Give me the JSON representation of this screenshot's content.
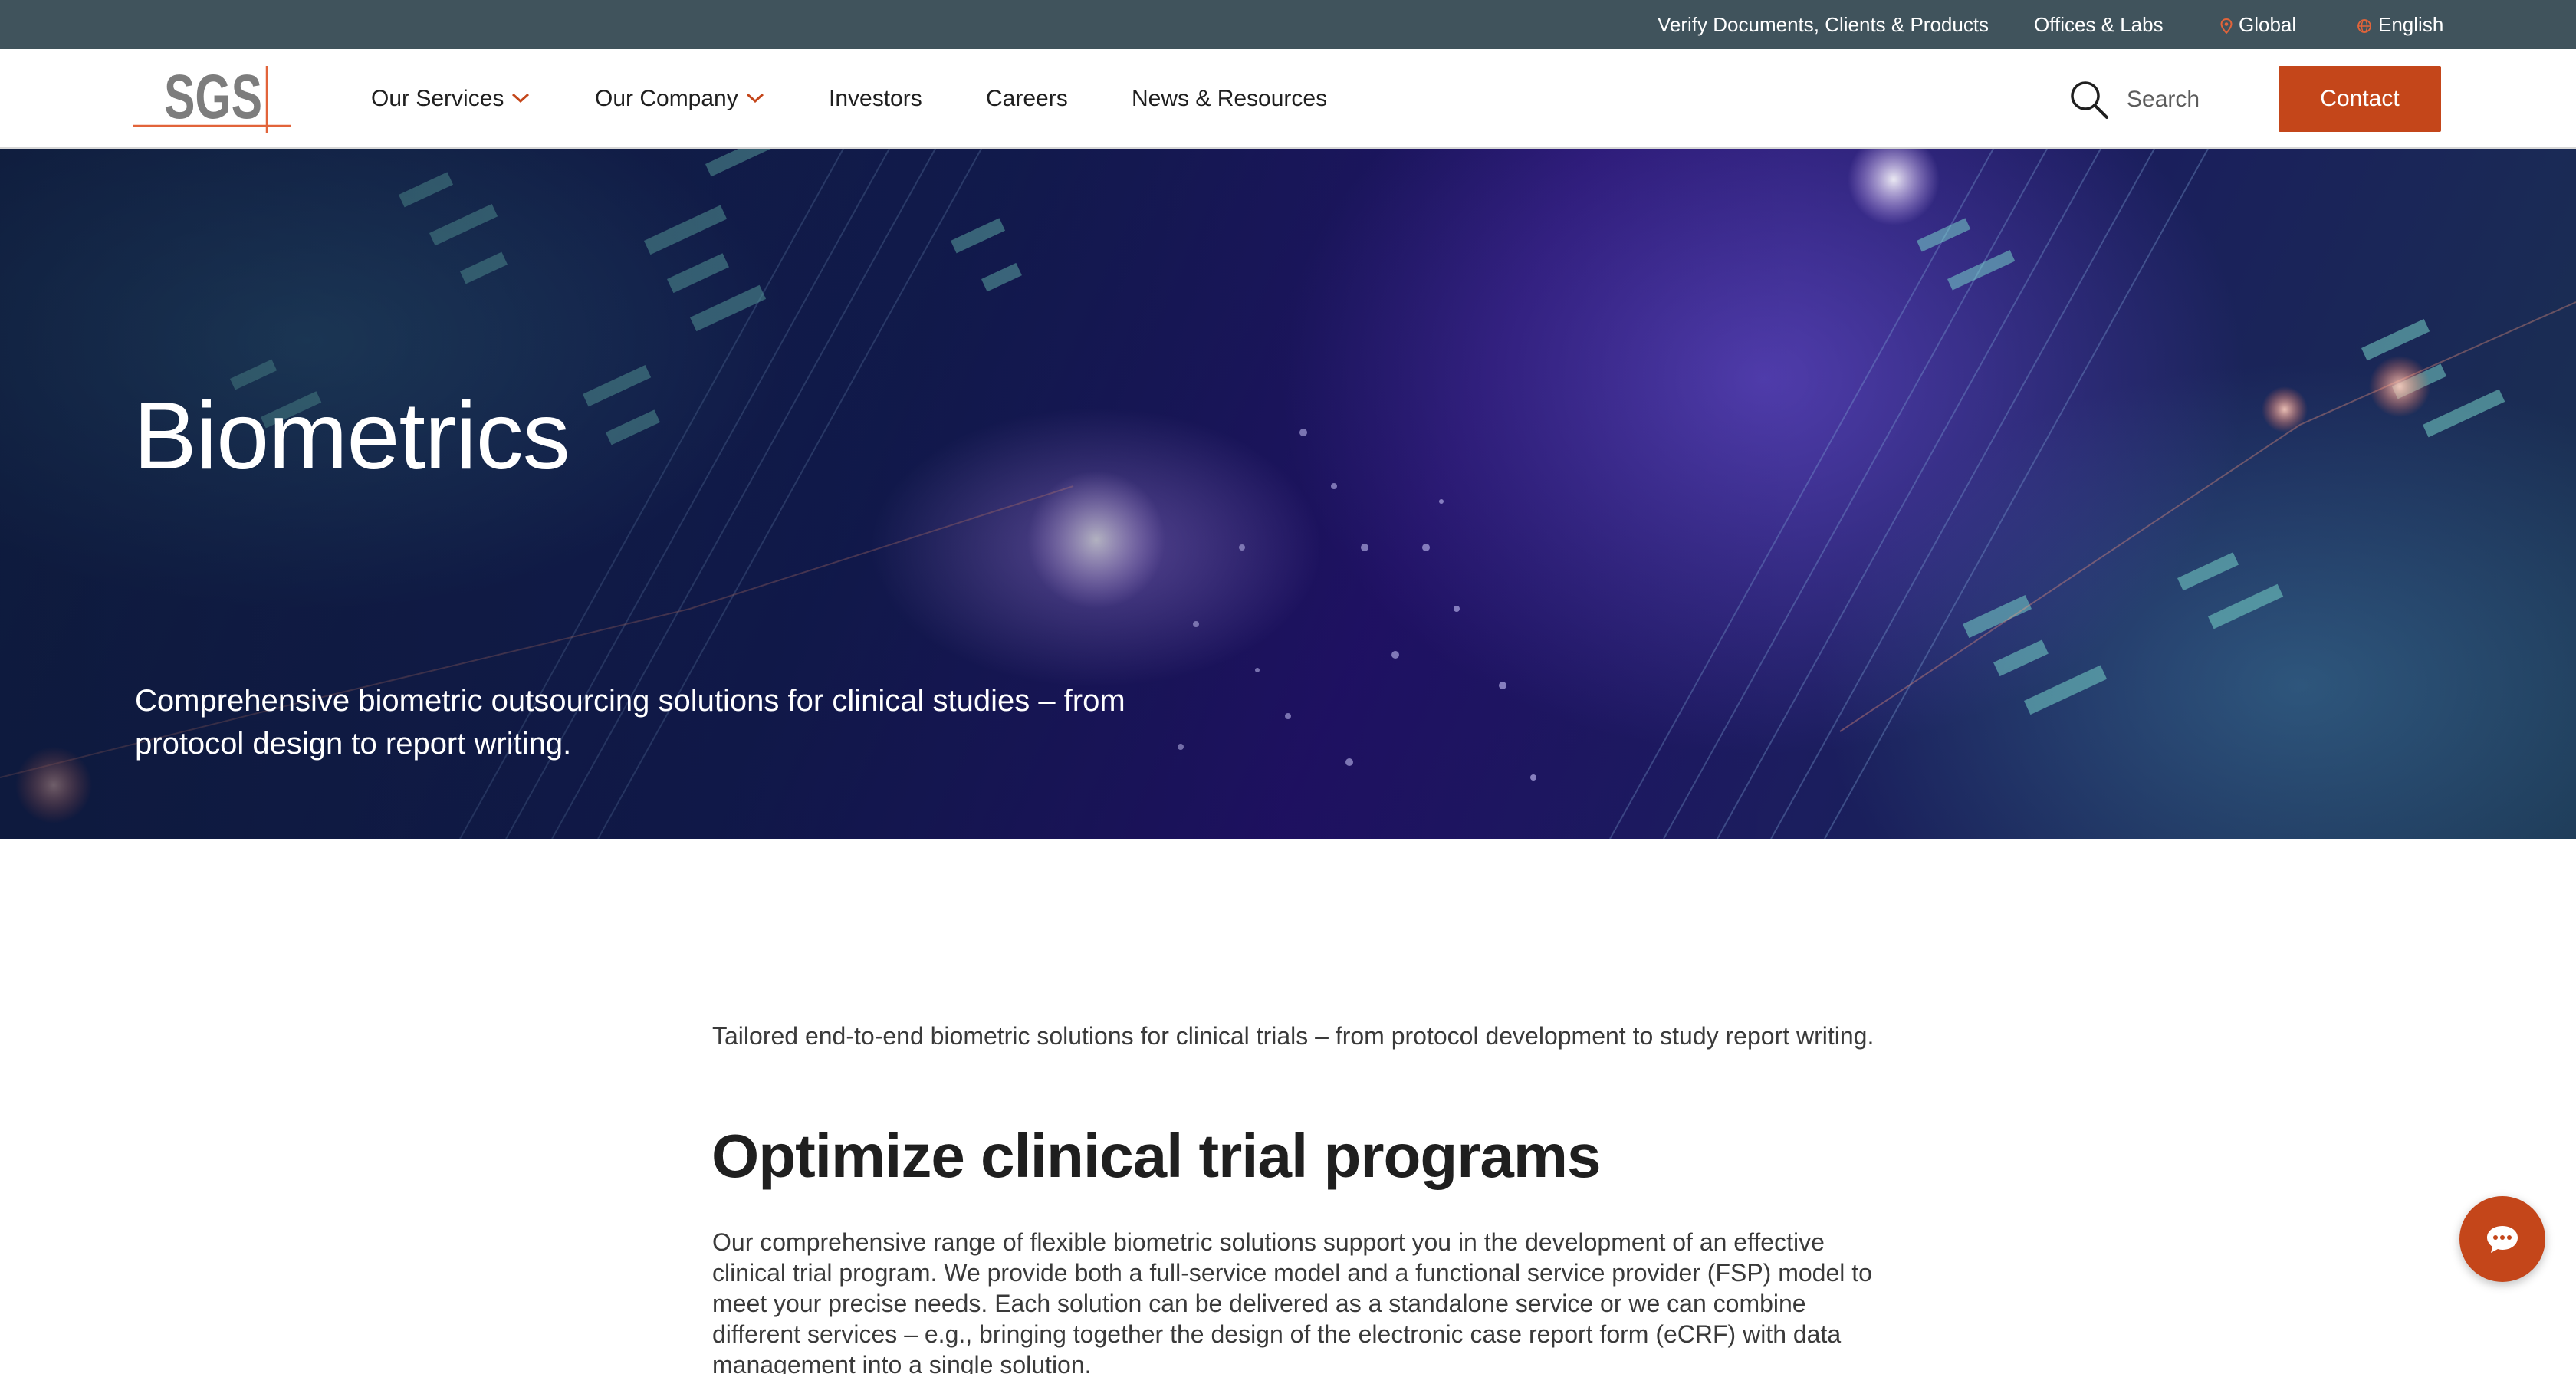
{
  "utility_bar": {
    "verify_label": "Verify Documents, Clients & Products",
    "offices_label": "Offices & Labs",
    "region_label": "Global",
    "language_label": "English"
  },
  "brand": {
    "logo_text": "SGS",
    "accent_color": "#c4461a",
    "utility_bar_color": "#40535c"
  },
  "nav": {
    "items": [
      {
        "label": "Our Services",
        "has_dropdown": true
      },
      {
        "label": "Our Company",
        "has_dropdown": true
      },
      {
        "label": "Investors",
        "has_dropdown": false
      },
      {
        "label": "Careers",
        "has_dropdown": false
      },
      {
        "label": "News & Resources",
        "has_dropdown": false
      }
    ],
    "search_placeholder": "Search",
    "contact_label": "Contact"
  },
  "hero": {
    "title": "Biometrics",
    "subtitle": "Comprehensive biometric outsourcing solutions for clinical studies – from protocol design to report writing."
  },
  "content": {
    "intro": "Tailored end-to-end biometric solutions for clinical trials – from protocol development to study report writing.",
    "heading": "Optimize clinical trial programs",
    "body": "Our comprehensive range of flexible biometric solutions support you in the development of an effective clinical trial program. We provide both a full-service model and a functional service provider (FSP) model to meet your precise needs. Each solution can be delivered as a standalone service or we can combine different services – e.g., bringing together the design of the electronic case report form (eCRF) with data management into a single solution."
  },
  "icons": {
    "region": "location-pin-icon",
    "language": "globe-icon",
    "dropdown": "chevron-down-icon",
    "search": "search-icon",
    "chat": "chat-bubble-icon"
  }
}
